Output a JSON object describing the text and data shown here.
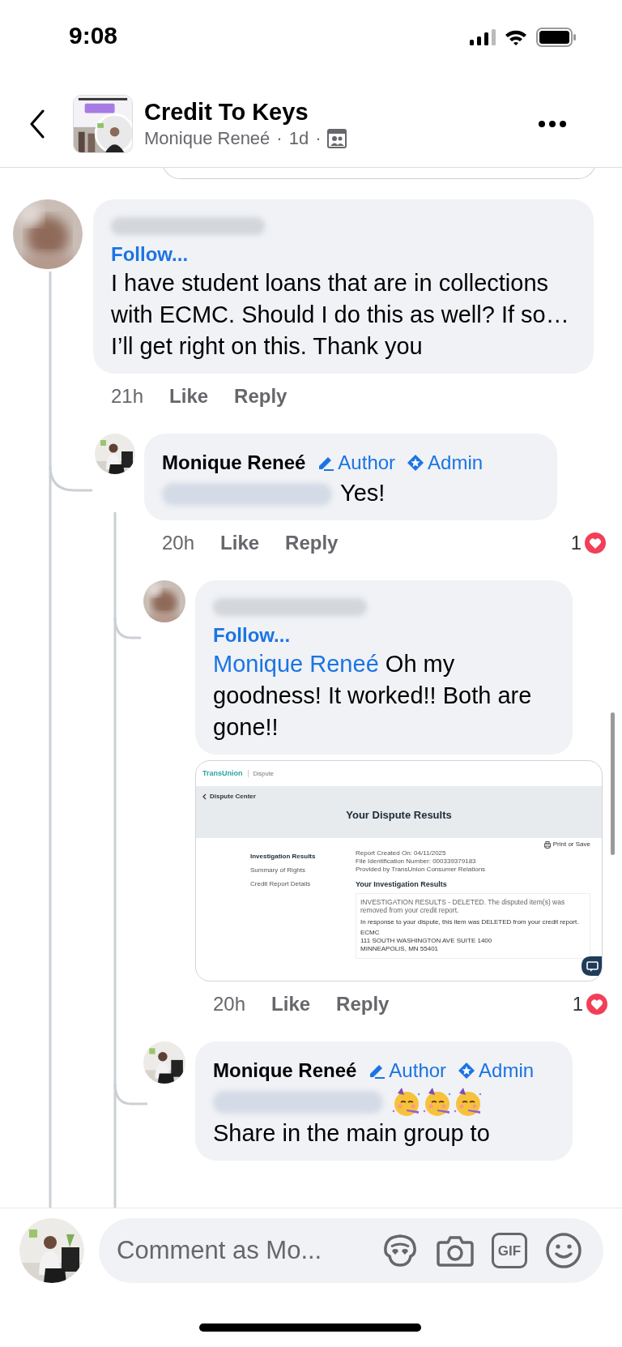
{
  "status_bar": {
    "time": "9:08"
  },
  "header": {
    "title": "Credit To Keys",
    "author": "Monique Reneé",
    "age": "1d",
    "separator": "·"
  },
  "comments": [
    {
      "follow": "Follow...",
      "body": [
        {
          "kind": "text",
          "text": "I have student loans that are in collections with ECMC. Should I do this as well?  If so…I’ll get right on this. Thank you"
        }
      ],
      "time": "21h",
      "actions": [
        "Like",
        "Reply"
      ],
      "children": [
        {
          "author": "Monique Reneé",
          "badges": [
            {
              "kind": "author",
              "label": "Author"
            },
            {
              "kind": "admin",
              "label": "Admin"
            }
          ],
          "body": [
            {
              "kind": "blur"
            },
            {
              "kind": "text",
              "text": "Yes!"
            }
          ],
          "time": "20h",
          "actions": [
            "Like",
            "Reply"
          ],
          "reactions": "1",
          "children": [
            {
              "follow": "Follow...",
              "body": [
                {
                  "kind": "link",
                  "text": "Monique Reneé"
                },
                {
                  "kind": "text",
                  "text": " Oh my goodness!  It worked!!  Both are gone!!"
                }
              ],
              "attachment": {
                "kind": "document",
                "brand": "TransUnion",
                "section": "Dispute",
                "back": "Dispute Center",
                "title": "Your Dispute Results",
                "print": "Print or Save",
                "nav": [
                  {
                    "label": "Investigation Results",
                    "selected": true
                  },
                  {
                    "label": "Summary of Rights",
                    "selected": false
                  },
                  {
                    "label": "Credit Report Details",
                    "selected": false
                  }
                ],
                "meta": [
                  "Report Created On: 04/11/2025",
                  "File Identification Number: 000339379183",
                  "Provided by TransUnion Consumer Relations"
                ],
                "heading": "Your Investigation Results",
                "result": "INVESTIGATION RESULTS - DELETED. The disputed item(s) was removed from your credit report.",
                "note": "In response to your dispute, this item was DELETED from your credit report.",
                "address": [
                  "ECMC",
                  "111 SOUTH WASHINGTON AVE SUITE 1400",
                  "MINNEAPOLIS, MN 55401"
                ]
              },
              "time": "20h",
              "actions": [
                "Like",
                "Reply"
              ],
              "reactions": "1"
            },
            {
              "author": "Monique Reneé",
              "badges": [
                {
                  "kind": "author",
                  "label": "Author"
                },
                {
                  "kind": "admin",
                  "label": "Admin"
                }
              ],
              "body": [
                {
                  "kind": "blur"
                },
                {
                  "kind": "emoji"
                },
                {
                  "kind": "emoji"
                },
                {
                  "kind": "emoji"
                },
                {
                  "kind": "break"
                },
                {
                  "kind": "text",
                  "text": "Share in the main group to"
                }
              ]
            }
          ]
        }
      ]
    }
  ],
  "composer": {
    "placeholder": "Comment as Mo...",
    "gif": "GIF"
  }
}
